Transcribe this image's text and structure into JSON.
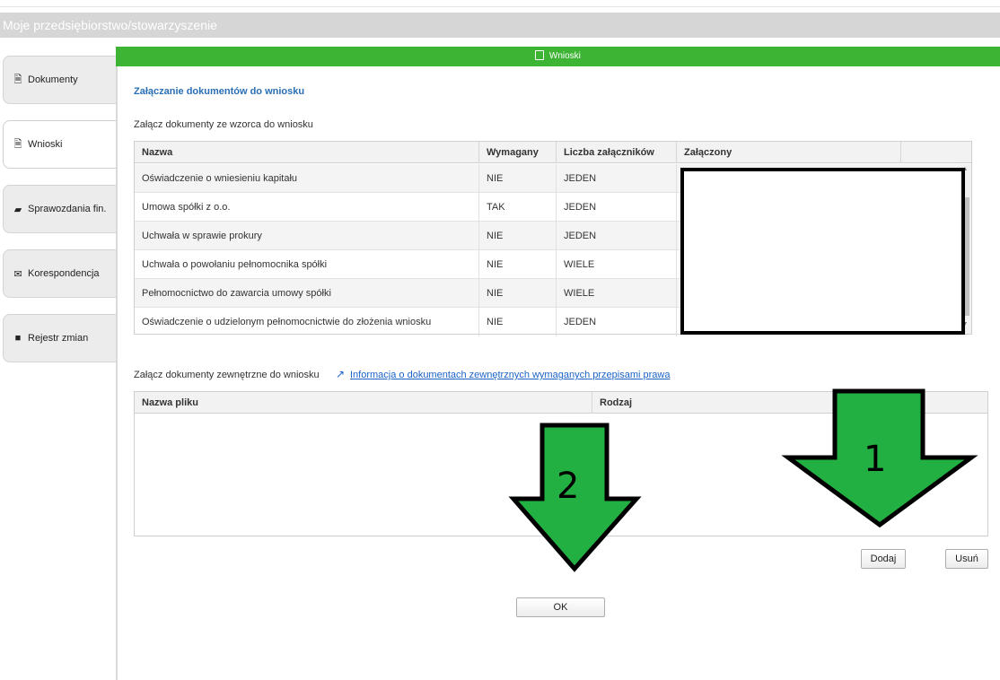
{
  "header": {
    "title": "Moje przedsiębiorstwo/stowarzyszenie"
  },
  "sidebar": {
    "tabs": [
      {
        "label": "Dokumenty",
        "icon": "document-icon"
      },
      {
        "label": "Wnioski",
        "icon": "application-icon"
      },
      {
        "label": "Sprawozdania fin.",
        "icon": "folder-icon"
      },
      {
        "label": "Korespondencja",
        "icon": "envelope-icon"
      },
      {
        "label": "Rejestr zmian",
        "icon": "briefcase-icon"
      }
    ],
    "active": "Wnioski"
  },
  "panel": {
    "title": "Wnioski"
  },
  "main": {
    "section_title": "Załączanie dokumentów do wniosku",
    "template_label": "Załącz dokumenty ze wzorca do wniosku",
    "template_table": {
      "columns": [
        "Nazwa",
        "Wymagany",
        "Liczba załączników",
        "Załączony"
      ],
      "rows": [
        [
          "Oświadczenie o wniesieniu kapitału",
          "NIE",
          "JEDEN"
        ],
        [
          "Umowa spółki z o.o.",
          "TAK",
          "JEDEN"
        ],
        [
          "Uchwała w sprawie prokury",
          "NIE",
          "JEDEN"
        ],
        [
          "Uchwała o powołaniu pełnomocnika spółki",
          "NIE",
          "WIELE"
        ],
        [
          "Pełnomocnictwo do zawarcia umowy spółki",
          "NIE",
          "WIELE"
        ],
        [
          "Oświadczenie o udzielonym pełnomocnictwie do złożenia wniosku",
          "NIE",
          "JEDEN"
        ]
      ]
    },
    "external_label": "Załącz dokumenty zewnętrzne do wniosku",
    "external_link": "Informacja o dokumentach zewnętrznych wymaganych przepisami prawa",
    "external_table": {
      "columns": [
        "Nazwa pliku",
        "Rodzaj"
      ]
    },
    "buttons": {
      "add": "Dodaj",
      "remove": "Usuń",
      "ok": "OK"
    }
  },
  "annotations": {
    "arrow1": "1",
    "arrow2": "2"
  },
  "colors": {
    "green": "#3eb435",
    "arrow_green": "#23b042",
    "link_blue": "#1b63c7",
    "header_gray": "#d6d6d6"
  }
}
